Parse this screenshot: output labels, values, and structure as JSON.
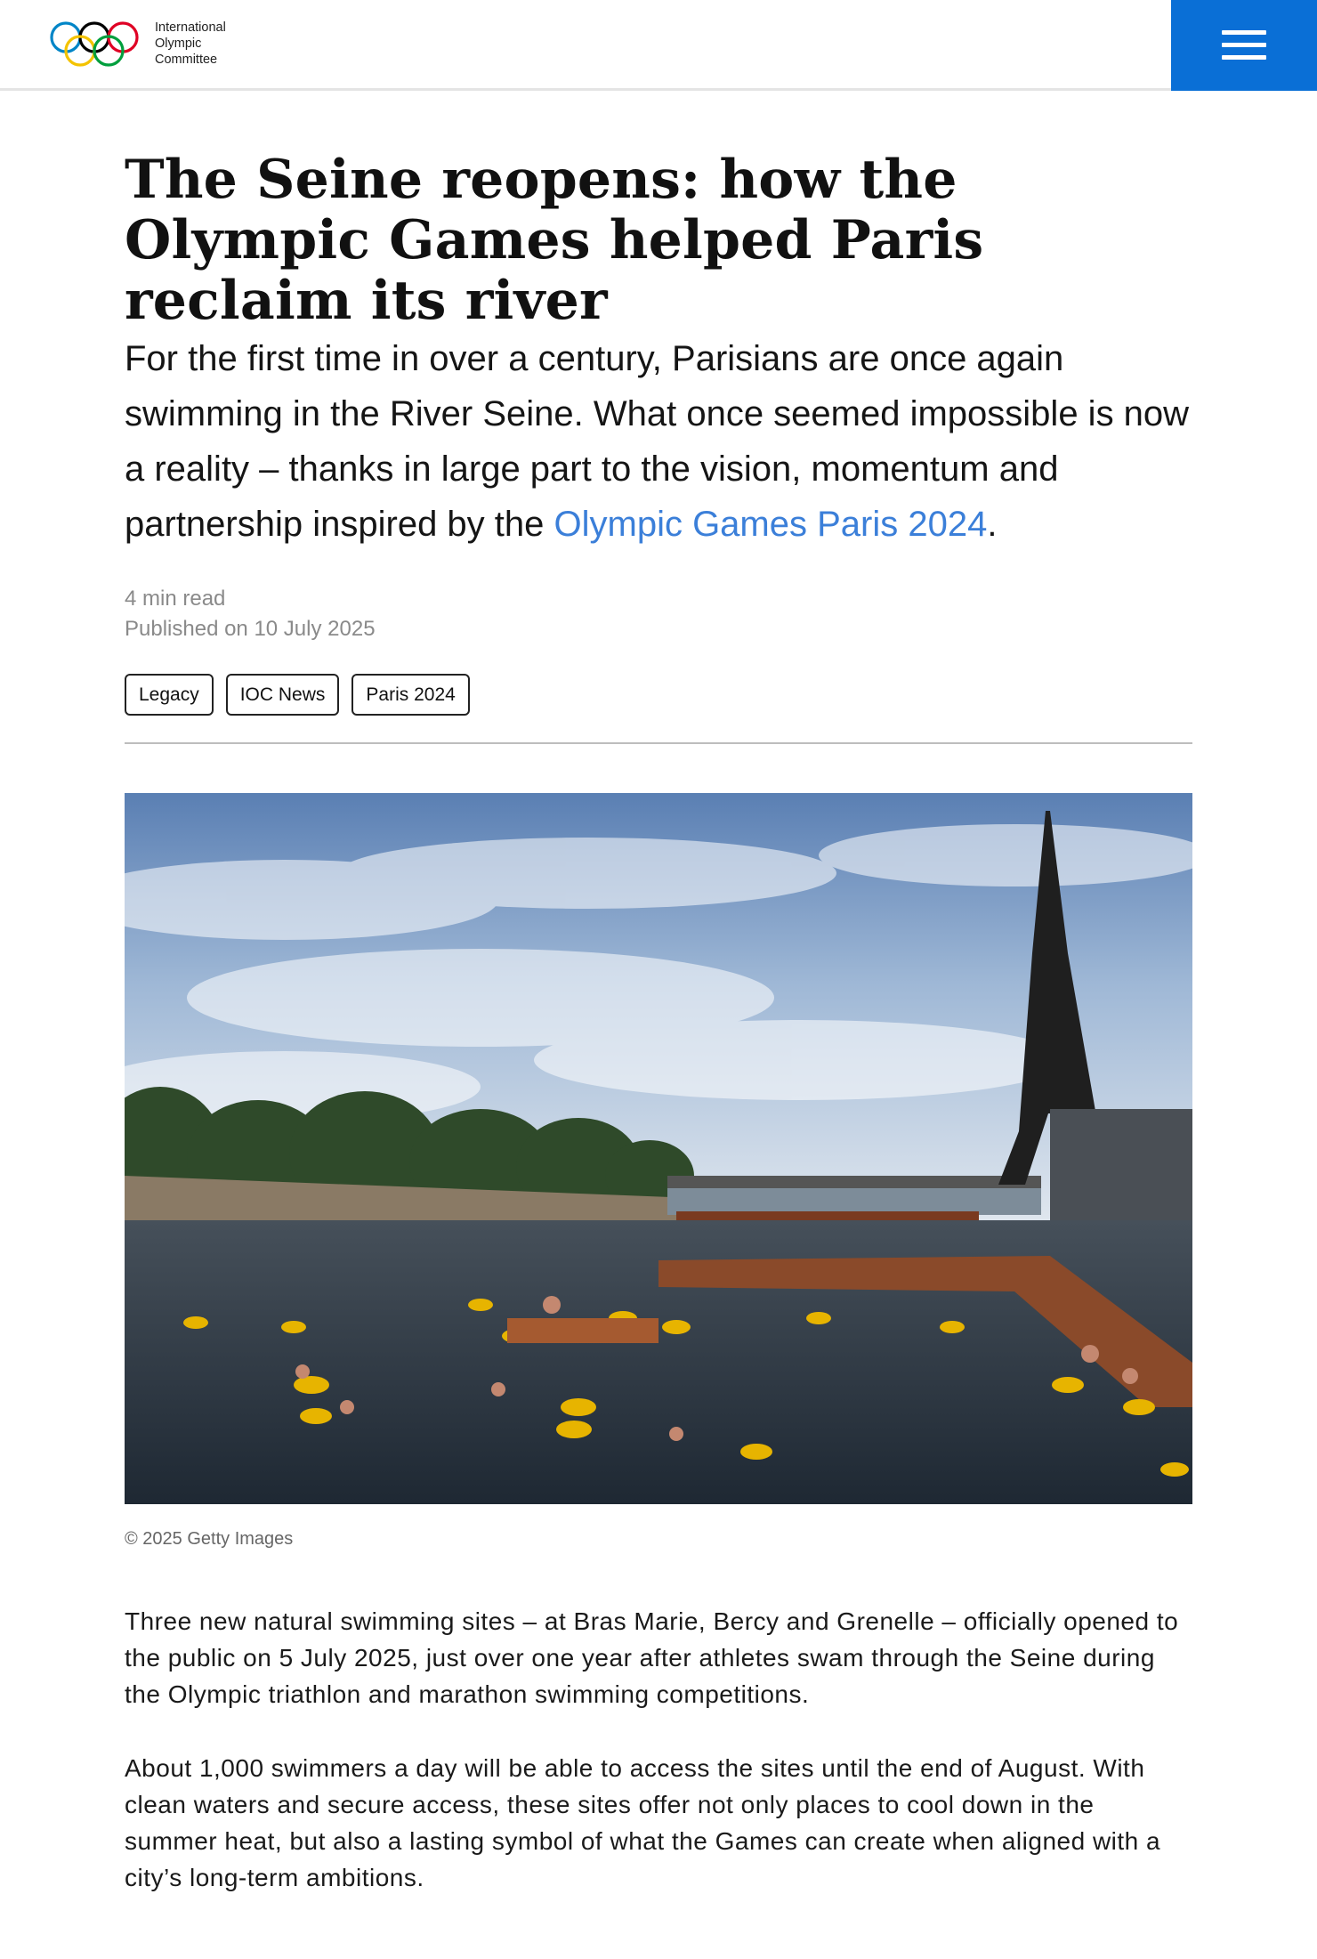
{
  "header": {
    "logo_lines": [
      "International",
      "Olympic",
      "Committee"
    ],
    "menu_icon": "hamburger-menu-icon",
    "menu_color": "#0a6fd6"
  },
  "article": {
    "title": "The Seine reopens: how the Olympic Games helped Paris reclaim its river",
    "lead_text": "For the first time in over a century, Parisians are once again swimming in the River Seine. What once seemed impossible is now a reality – thanks in large part to the vision, momentum and partnership inspired by the ",
    "lead_link": "Olympic Games Paris 2024",
    "lead_end": ".",
    "read_time": "4 min read",
    "published": "Published on 10 July 2025",
    "tags": [
      "Legacy",
      "IOC News",
      "Paris 2024"
    ],
    "image_caption": "© 2025 Getty Images",
    "paragraphs": [
      "Three new natural swimming sites – at Bras Marie, Bercy and Grenelle – officially opened to the public on 5 July 2025, just over one year after athletes swam through the Seine during the Olympic triathlon and marathon swimming competitions.",
      "About 1,000 swimmers a day will be able to access the sites until the end of August. With clean waters and secure access, these sites offer not only places to cool down in the summer heat, but also a lasting symbol of what the Games can create when aligned with a city’s long-term ambitions."
    ]
  },
  "colors": {
    "link": "#3b7fd9",
    "ring_blue": "#0085c7",
    "ring_yellow": "#f4c300",
    "ring_black": "#000000",
    "ring_green": "#009f3d",
    "ring_red": "#df0024"
  }
}
